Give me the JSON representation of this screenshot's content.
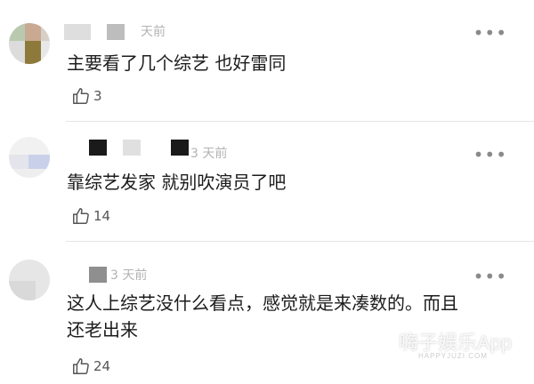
{
  "comments": [
    {
      "time": "天前",
      "text": "主要看了几个综艺 也好雷同",
      "likes": "3"
    },
    {
      "time": "3 天前",
      "text": "靠综艺发家 就别吹演员了吧",
      "likes": "14"
    },
    {
      "time": "3 天前",
      "text_line1": "这人上综艺没什么看点，感觉就是来凑数的。而且",
      "text_line2": "还老出来",
      "likes": "24"
    }
  ],
  "more_label": "•••",
  "watermark": {
    "brand": "嗨子娱乐App",
    "url": "HAPPYJUZI.COM"
  },
  "colors": {
    "time": "#b3b3b3",
    "divider": "#e6e6e6",
    "more": "#8a8a8a"
  }
}
